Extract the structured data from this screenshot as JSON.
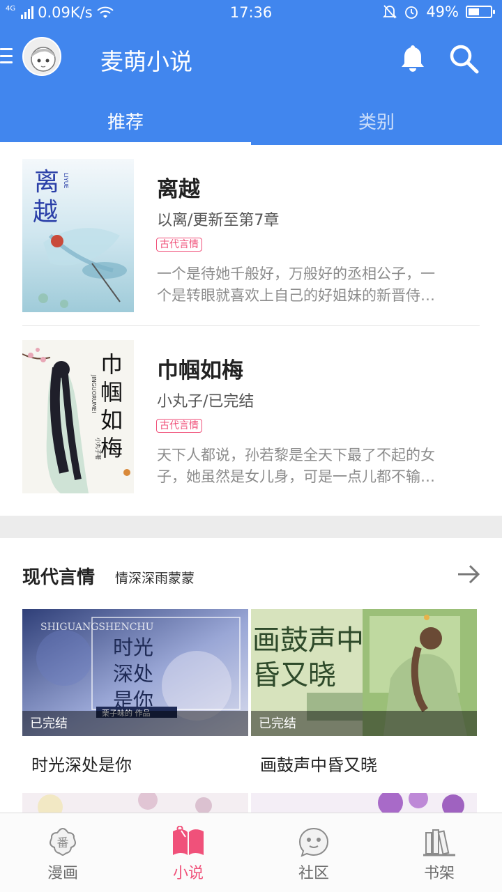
{
  "status": {
    "network": "4G",
    "speed": "0.09K/s",
    "time": "17:36",
    "battery": "49%",
    "battery_level": 0.49
  },
  "header": {
    "title": "麦萌小说",
    "tabs": [
      {
        "label": "推荐",
        "active": true
      },
      {
        "label": "类别",
        "active": false
      }
    ]
  },
  "books": [
    {
      "title": "离越",
      "meta": "以离/更新至第7章",
      "tag": "古代言情",
      "desc_line1": "一个是待她千般好，万般好的丞相公子，一",
      "desc_line2": "个是转眼就喜欢上自己的好姐妹的新晋侍…",
      "cover_text": "离越",
      "cover_subtext": "LIYUE"
    },
    {
      "title": "巾帼如梅",
      "meta": "小丸子/已完结",
      "tag": "古代言情",
      "desc_line1": "天下人都说，孙若黎是全天下最了不起的女",
      "desc_line2": "子，她虽然是女儿身，可是一点儿都不输…",
      "cover_text": "巾帼如梅",
      "cover_subtext": "JINGUORUMEI",
      "cover_author": "小丸子著"
    }
  ],
  "section": {
    "title": "现代言情",
    "subtitle": "情深深雨蒙蒙",
    "items": [
      {
        "name": "时光深处是你",
        "badge": "已完结",
        "cover_lines": [
          "时光",
          "深处",
          "是你"
        ],
        "cover_top": "SHIGUANGSHENCHU",
        "cover_caption": "栗子味的 作品"
      },
      {
        "name": "画鼓声中昏又晓",
        "badge": "已完结",
        "cover_lines": [
          "画鼓声中",
          "昏又晓"
        ]
      }
    ]
  },
  "bottom_nav": [
    {
      "label": "漫画",
      "icon": "comic-icon",
      "active": false,
      "glyph": "番"
    },
    {
      "label": "小说",
      "icon": "novel-icon",
      "active": true
    },
    {
      "label": "社区",
      "icon": "community-icon",
      "active": false
    },
    {
      "label": "书架",
      "icon": "bookshelf-icon",
      "active": false
    }
  ],
  "colors": {
    "brand": "#4186ee",
    "accent": "#f0517a"
  }
}
